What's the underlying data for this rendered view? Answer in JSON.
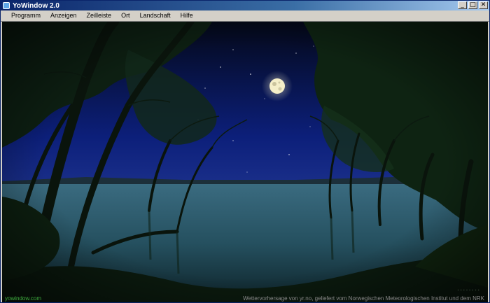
{
  "window": {
    "title": "YoWindow 2.0"
  },
  "title_controls": [
    {
      "name": "minimize-button",
      "glyph": "_"
    },
    {
      "name": "maximize-button",
      "glyph": "□"
    },
    {
      "name": "close-button",
      "glyph": "✕"
    }
  ],
  "menu": [
    {
      "name": "menu-programm",
      "label": "Programm"
    },
    {
      "name": "menu-anzeigen",
      "label": "Anzeigen"
    },
    {
      "name": "menu-zeilleiste",
      "label": "Zeilleiste"
    },
    {
      "name": "menu-ort",
      "label": "Ort"
    },
    {
      "name": "menu-landschaft",
      "label": "Landschaft"
    },
    {
      "name": "menu-hilfe",
      "label": "Hilfe"
    }
  ],
  "scene": {
    "description_icon": "night-lake-landscape",
    "moon_icon": "full-moon-icon",
    "sky_color": "#0a1a6a",
    "lake_color": "#2a5a70"
  },
  "footer": {
    "left_link": "yowindow.com",
    "right_credit": "Wettervorhersage von yr.no, geliefert vom Norwegischen Meteorologischen Institut und dem NRK",
    "link_color": "#3fae3f"
  }
}
